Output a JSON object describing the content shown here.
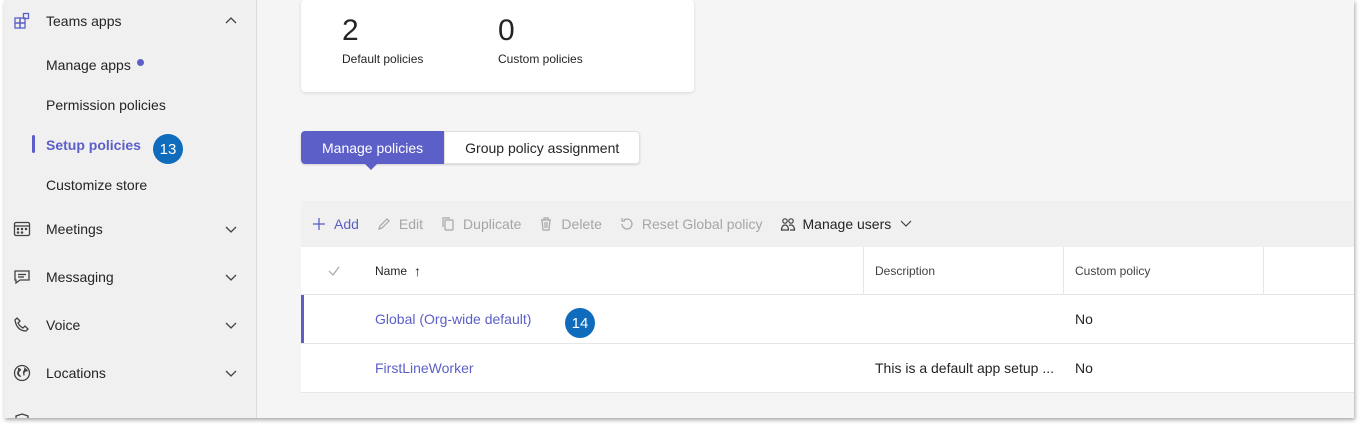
{
  "sidebar": {
    "teams_apps": {
      "label": "Teams apps"
    },
    "sub_items": [
      {
        "label": "Manage apps"
      },
      {
        "label": "Permission policies"
      },
      {
        "label": "Setup policies"
      },
      {
        "label": "Customize store"
      }
    ],
    "groups": [
      {
        "label": "Meetings"
      },
      {
        "label": "Messaging"
      },
      {
        "label": "Voice"
      },
      {
        "label": "Locations"
      }
    ]
  },
  "callouts": {
    "setup_policies": "13",
    "global_row": "14"
  },
  "stats": {
    "default": {
      "value": "2",
      "label": "Default policies"
    },
    "custom": {
      "value": "0",
      "label": "Custom policies"
    }
  },
  "tabs": [
    {
      "label": "Manage policies"
    },
    {
      "label": "Group policy assignment"
    }
  ],
  "toolbar": {
    "add": "Add",
    "edit": "Edit",
    "duplicate": "Duplicate",
    "delete": "Delete",
    "reset": "Reset Global policy",
    "manage_users": "Manage users"
  },
  "table": {
    "headers": {
      "name": "Name",
      "sort_indicator": "↑",
      "description": "Description",
      "custom": "Custom policy"
    },
    "rows": [
      {
        "name": "Global (Org-wide default)",
        "description": "",
        "custom": "No"
      },
      {
        "name": "FirstLineWorker",
        "description": "This is a default app setup ...",
        "custom": "No"
      }
    ]
  },
  "colors": {
    "accent": "#5b5fc7",
    "callout": "#0f6cbd"
  }
}
